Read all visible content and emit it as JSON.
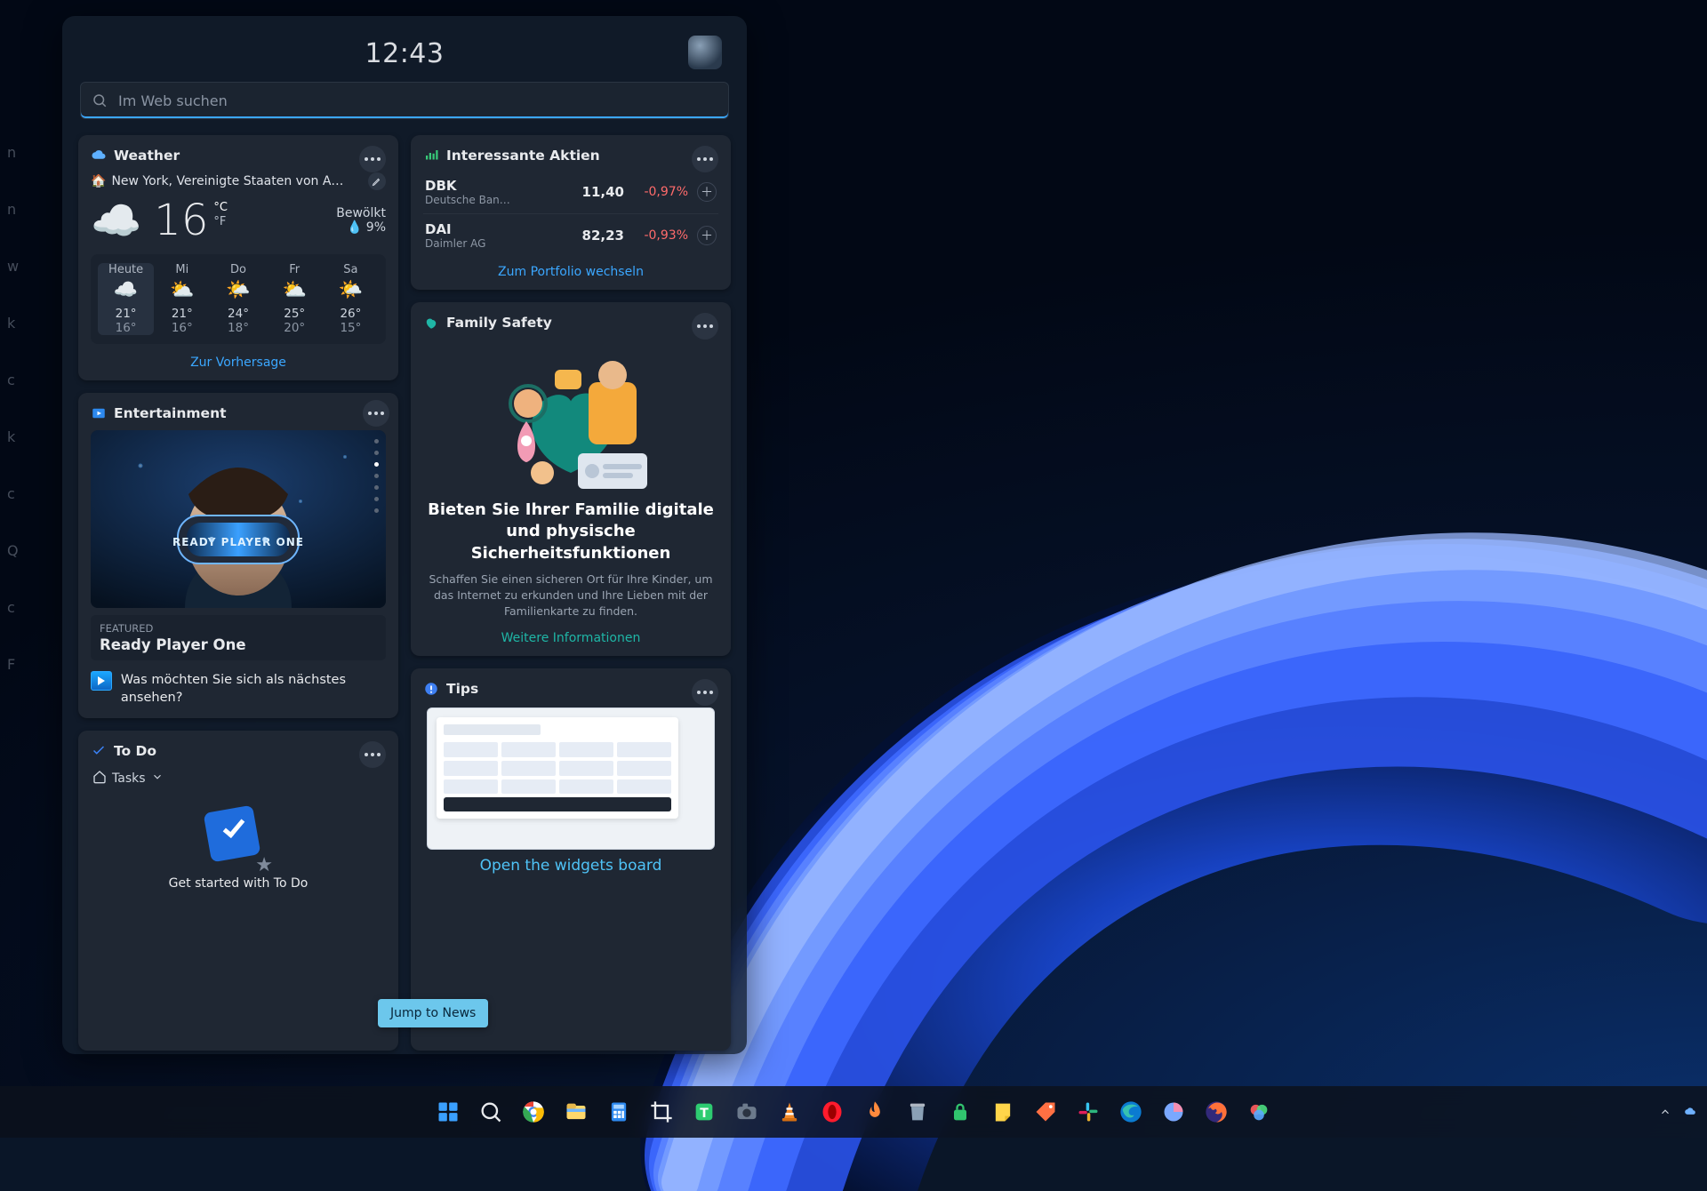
{
  "time": "12:43",
  "search": {
    "placeholder": "Im Web suchen"
  },
  "weather": {
    "title": "Weather",
    "location": "New York, Vereinigte Staaten von A…",
    "temp": "16",
    "unit_c": "°C",
    "unit_f": "°F",
    "condition": "Bewölkt",
    "humidity": "9%",
    "days": [
      {
        "name": "Heute",
        "hi": "21°",
        "lo": "16°",
        "icon": "☁️"
      },
      {
        "name": "Mi",
        "hi": "21°",
        "lo": "16°",
        "icon": "⛅"
      },
      {
        "name": "Do",
        "hi": "24°",
        "lo": "18°",
        "icon": "🌤️"
      },
      {
        "name": "Fr",
        "hi": "25°",
        "lo": "20°",
        "icon": "⛅"
      },
      {
        "name": "Sa",
        "hi": "26°",
        "lo": "15°",
        "icon": "🌤️"
      }
    ],
    "forecast_link": "Zur Vorhersage"
  },
  "stocks": {
    "title": "Interessante Aktien",
    "rows": [
      {
        "sym": "DBK",
        "name": "Deutsche Ban…",
        "price": "11,40",
        "change": "-0,97%"
      },
      {
        "sym": "DAI",
        "name": "Daimler AG",
        "price": "82,23",
        "change": "-0,93%"
      }
    ],
    "portfolio_link": "Zum Portfolio wechseln"
  },
  "family": {
    "title": "Family Safety",
    "headline": "Bieten Sie Ihrer Familie digitale und physische Sicherheitsfunktionen",
    "body": "Schaffen Sie einen sicheren Ort für Ihre Kinder, um das Internet zu erkunden und Ihre Lieben mit der Familienkarte zu finden.",
    "link": "Weitere Informationen"
  },
  "entertainment": {
    "title": "Entertainment",
    "featured_label": "FEATURED",
    "featured_title": "Ready Player One",
    "question": "Was möchten Sie sich als nächstes ansehen?"
  },
  "todo": {
    "title": "To Do",
    "tasks_label": "Tasks",
    "cta": "Get started with To Do"
  },
  "tips": {
    "title": "Tips",
    "caption": "Open the widgets board"
  },
  "tooltip": "Jump to News",
  "taskbar": {
    "items": [
      "start",
      "search",
      "chrome",
      "explorer",
      "calculator",
      "crop",
      "text",
      "camera",
      "vlc",
      "opera",
      "flame",
      "trash",
      "lock",
      "sticky",
      "tag",
      "slack",
      "edge",
      "pie",
      "firefox",
      "colors"
    ]
  },
  "left_edge": [
    "n",
    "n",
    "w",
    "k",
    "c",
    "k",
    "c",
    "Q",
    "c",
    "F"
  ]
}
